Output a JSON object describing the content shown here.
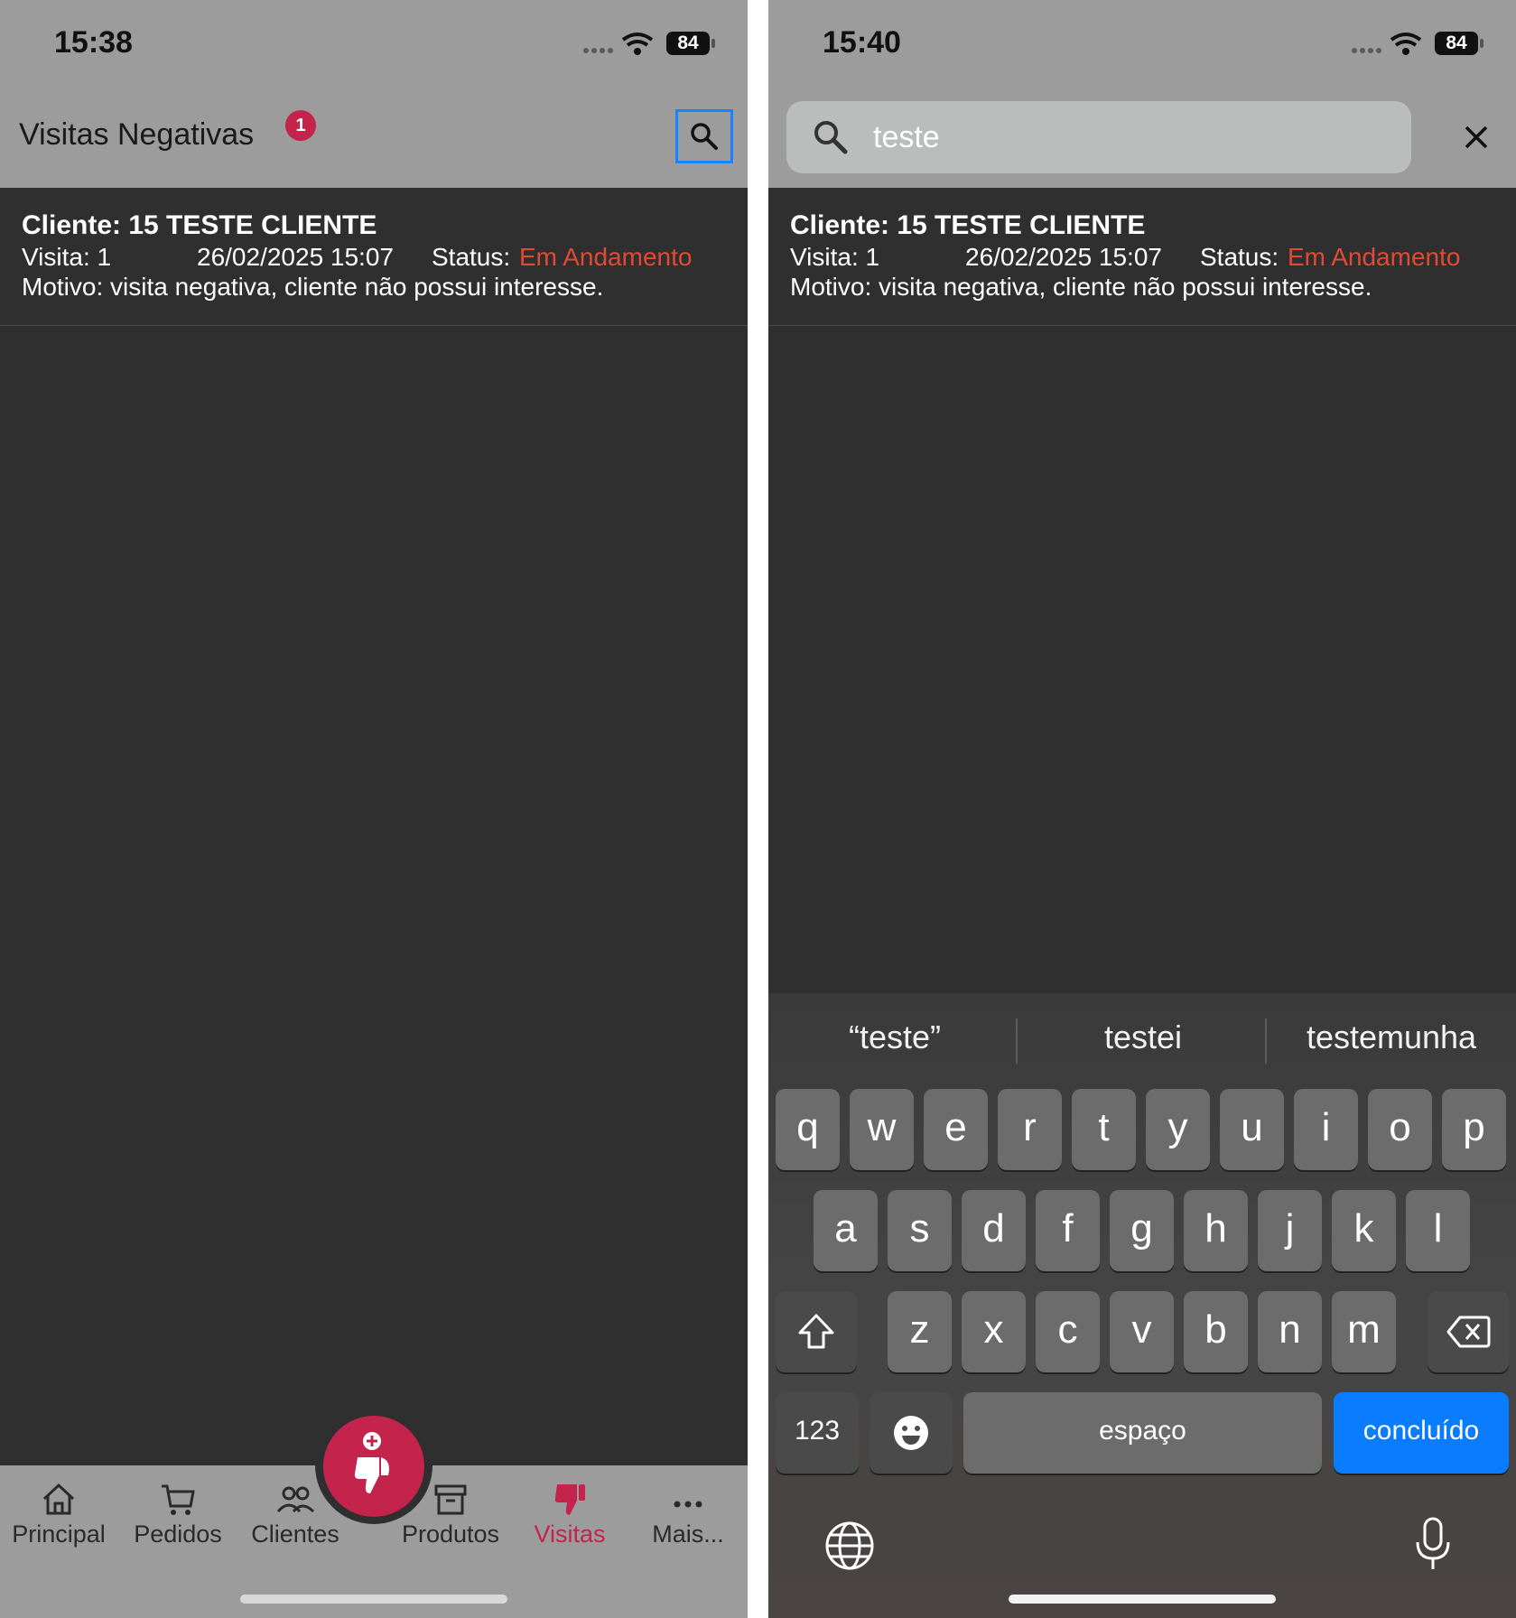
{
  "colors": {
    "accent": "#c4234c",
    "status_in_progress": "#e14b35",
    "header_bg": "#9c9c9c",
    "content_bg": "#2f2f2f",
    "keyboard_done": "#0a7cff"
  },
  "left": {
    "status_bar": {
      "time": "15:38",
      "battery": "84"
    },
    "header": {
      "title": "Visitas Negativas",
      "badge_count": "1",
      "search_icon": "search-icon"
    },
    "list": [
      {
        "client": "Cliente: 15 TESTE CLIENTE",
        "visit": "Visita: 1",
        "datetime": "26/02/2025 15:07",
        "status_label": "Status:",
        "status_value": "Em Andamento",
        "reason": "Motivo: visita negativa, cliente não possui interesse."
      }
    ],
    "tabs": [
      {
        "label": "Principal",
        "icon": "home-icon"
      },
      {
        "label": "Pedidos",
        "icon": "cart-icon"
      },
      {
        "label": "Clientes",
        "icon": "users-icon"
      },
      {
        "label": "Produtos",
        "icon": "archive-icon"
      },
      {
        "label": "Visitas",
        "icon": "thumbs-down-icon",
        "active": true
      },
      {
        "label": "Mais...",
        "icon": "more-icon"
      }
    ],
    "fab_icon": "add-negative-visit-icon"
  },
  "right": {
    "status_bar": {
      "time": "15:40",
      "battery": "84"
    },
    "search": {
      "value": "teste",
      "icon": "search-icon",
      "close_icon": "close-icon"
    },
    "list": [
      {
        "client": "Cliente: 15 TESTE CLIENTE",
        "visit": "Visita: 1",
        "datetime": "26/02/2025 15:07",
        "status_label": "Status:",
        "status_value": "Em Andamento",
        "reason": "Motivo: visita negativa, cliente não possui interesse."
      }
    ],
    "keyboard": {
      "suggestions": [
        "“teste”",
        "testei",
        "testemunha"
      ],
      "row1": [
        "q",
        "w",
        "e",
        "r",
        "t",
        "y",
        "u",
        "i",
        "o",
        "p"
      ],
      "row2": [
        "a",
        "s",
        "d",
        "f",
        "g",
        "h",
        "j",
        "k",
        "l"
      ],
      "row3": [
        "z",
        "x",
        "c",
        "v",
        "b",
        "n",
        "m"
      ],
      "numbers_key": "123",
      "space_key": "espaço",
      "done_key": "concluído",
      "shift_icon": "shift-icon",
      "delete_icon": "backspace-icon",
      "emoji_icon": "emoji-icon",
      "globe_icon": "globe-icon",
      "mic_icon": "microphone-icon"
    }
  }
}
